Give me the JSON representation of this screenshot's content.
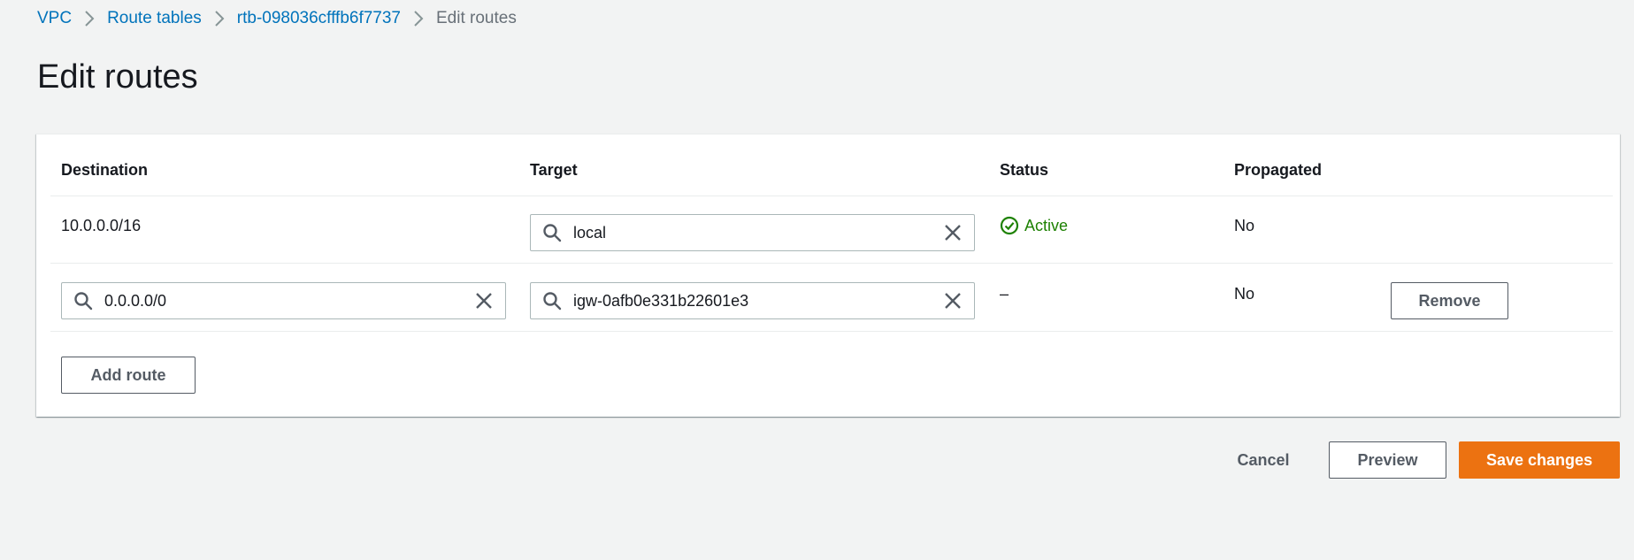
{
  "breadcrumb": {
    "items": [
      {
        "label": "VPC"
      },
      {
        "label": "Route tables"
      },
      {
        "label": "rtb-098036cfffb6f7737"
      }
    ],
    "current": "Edit routes"
  },
  "page": {
    "title": "Edit routes"
  },
  "table": {
    "headers": {
      "destination": "Destination",
      "target": "Target",
      "status": "Status",
      "propagated": "Propagated"
    },
    "rows": [
      {
        "destination": "10.0.0.0/16",
        "target": "local",
        "status": "Active",
        "propagated": "No"
      },
      {
        "destination": "0.0.0.0/0",
        "target": "igw-0afb0e331b22601e3",
        "status": "–",
        "propagated": "No",
        "remove_label": "Remove"
      }
    ],
    "add_route_label": "Add route"
  },
  "footer": {
    "cancel_label": "Cancel",
    "preview_label": "Preview",
    "save_label": "Save changes"
  },
  "colors": {
    "link": "#0073bb",
    "primary": "#ec7211",
    "success": "#1d8102",
    "background": "#f2f3f3"
  },
  "icons": [
    "chevron-right-icon",
    "search-icon",
    "close-icon",
    "status-success-icon"
  ]
}
